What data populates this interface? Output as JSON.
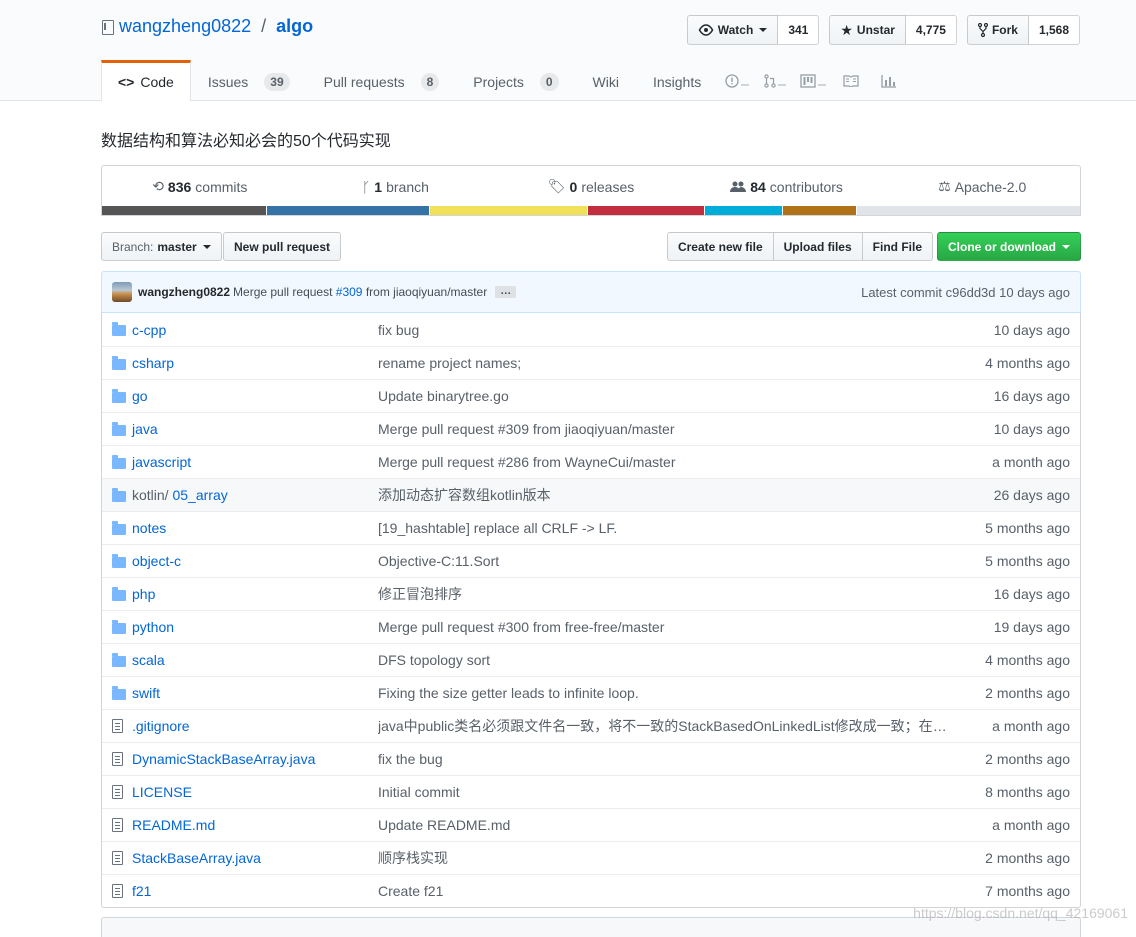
{
  "repo": {
    "owner": "wangzheng0822",
    "separator": "/",
    "name": "algo"
  },
  "actions": {
    "watch": {
      "label": "Watch",
      "count": "341"
    },
    "star": {
      "label": "Unstar",
      "count": "4,775"
    },
    "fork": {
      "label": "Fork",
      "count": "1,568"
    }
  },
  "tabs": [
    {
      "label": "Code"
    },
    {
      "label": "Issues",
      "count": "39"
    },
    {
      "label": "Pull requests",
      "count": "8"
    },
    {
      "label": "Projects",
      "count": "0"
    },
    {
      "label": "Wiki"
    },
    {
      "label": "Insights"
    }
  ],
  "description": "数据结构和算法必知必会的50个代码实现",
  "summary": {
    "commits": {
      "count": "836",
      "label": "commits"
    },
    "branches": {
      "count": "1",
      "label": "branch"
    },
    "releases": {
      "count": "0",
      "label": "releases"
    },
    "contributors": {
      "count": "84",
      "label": "contributors"
    },
    "license": "Apache-2.0"
  },
  "language_colors": [
    "#555555",
    "#3572A5",
    "#f1e05a",
    "#b07219",
    "#00ADD8",
    "#178600",
    "#438eff",
    "#c22d40",
    "#F05138",
    "#4F5D95"
  ],
  "toolbar": {
    "branch_prefix": "Branch:",
    "branch_name": "master",
    "new_pr": "New pull request",
    "create_file": "Create new file",
    "upload_files": "Upload files",
    "find_file": "Find File",
    "clone": "Clone or download"
  },
  "latest_commit": {
    "author": "wangzheng0822",
    "message_prefix": "Merge pull request",
    "pr": "#309",
    "message_suffix": "from jiaoqiyuan/master",
    "ellipsis": "…",
    "label": "Latest commit",
    "sha": "c96dd3d",
    "age": "10 days ago"
  },
  "files": [
    {
      "type": "dir",
      "name": "c-cpp",
      "message": "fix bug",
      "age": "10 days ago"
    },
    {
      "type": "dir",
      "name": "csharp",
      "message": "rename project names;",
      "age": "4 months ago"
    },
    {
      "type": "dir",
      "name": "go",
      "message": "Update binarytree.go",
      "age": "16 days ago"
    },
    {
      "type": "dir",
      "name": "java",
      "message": "Merge pull request #309 from jiaoqiyuan/master",
      "age": "10 days ago"
    },
    {
      "type": "dir",
      "name": "javascript",
      "message": "Merge pull request #286 from WayneCui/master",
      "age": "a month ago"
    },
    {
      "type": "dir",
      "name_prefix": "kotlin/",
      "name": "05_array",
      "message": "添加动态扩容数组kotlin版本",
      "age": "26 days ago"
    },
    {
      "type": "dir",
      "name": "notes",
      "message": "[19_hashtable] replace all CRLF -> LF.",
      "age": "5 months ago"
    },
    {
      "type": "dir",
      "name": "object-c",
      "message": "Objective-C:11.Sort",
      "age": "5 months ago"
    },
    {
      "type": "dir",
      "name": "php",
      "message": "修正冒泡排序",
      "age": "16 days ago"
    },
    {
      "type": "dir",
      "name": "python",
      "message": "Merge pull request #300 from free-free/master",
      "age": "19 days ago"
    },
    {
      "type": "dir",
      "name": "scala",
      "message": "DFS topology sort",
      "age": "4 months ago"
    },
    {
      "type": "dir",
      "name": "swift",
      "message": "Fixing the size getter leads to infinite loop.",
      "age": "2 months ago"
    },
    {
      "type": "file",
      "name": ".gitignore",
      "message": "java中public类名必须跟文件名一致，将不一致的StackBasedOnLinkedList修改成一致；在....",
      "age": "a month ago"
    },
    {
      "type": "file",
      "name": "DynamicStackBaseArray.java",
      "message": "fix the bug",
      "age": "2 months ago"
    },
    {
      "type": "file",
      "name": "LICENSE",
      "message": "Initial commit",
      "age": "8 months ago"
    },
    {
      "type": "file",
      "name": "README.md",
      "message": "Update README.md",
      "age": "a month ago"
    },
    {
      "type": "file",
      "name": "StackBaseArray.java",
      "message": "顺序栈实现",
      "age": "2 months ago"
    },
    {
      "type": "file",
      "name": "f21",
      "message": "Create f21",
      "age": "7 months ago"
    }
  ],
  "watermark": "https://blog.csdn.net/qq_42169061"
}
